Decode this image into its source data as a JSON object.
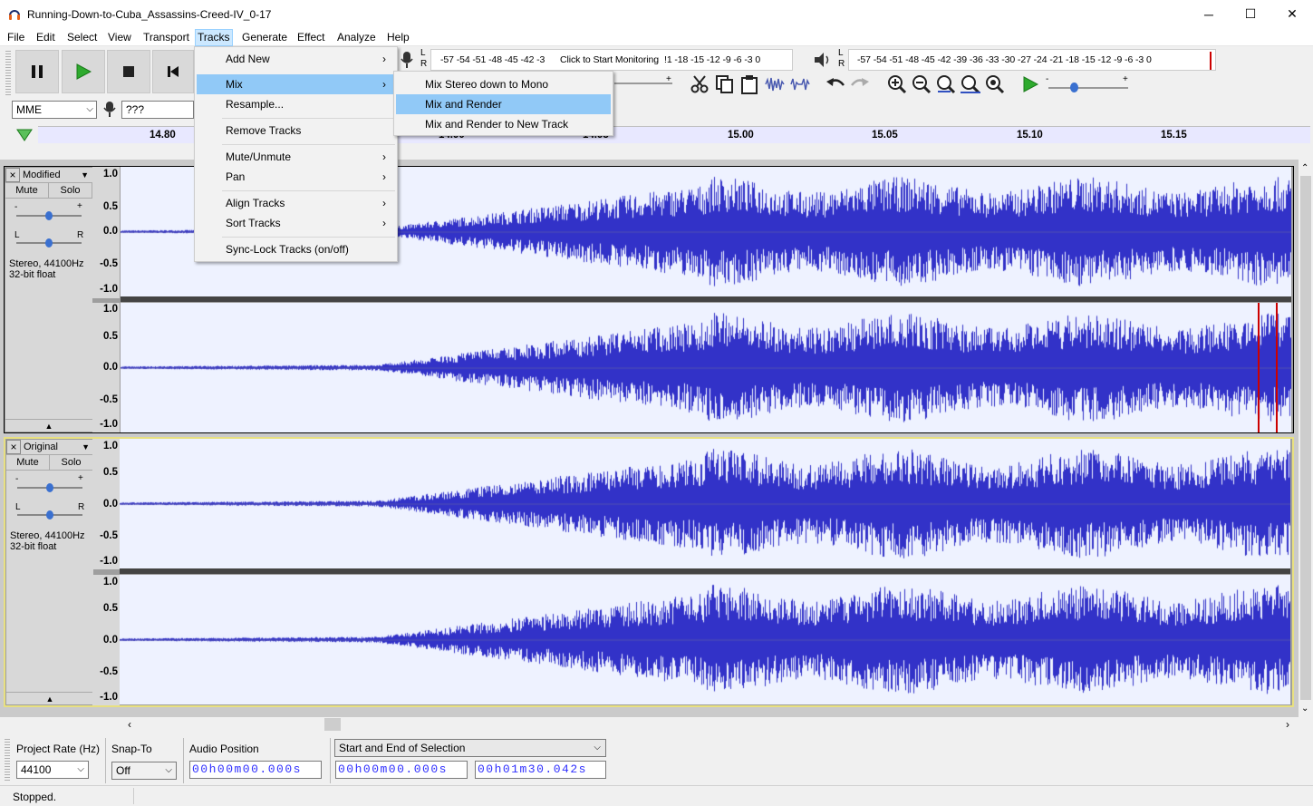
{
  "window": {
    "title": "Running-Down-to-Cuba_Assassins-Creed-IV_0-17",
    "minimize": "─",
    "maximize": "☐",
    "close": "✕"
  },
  "menubar": [
    "File",
    "Edit",
    "Select",
    "View",
    "Transport",
    "Tracks",
    "Generate",
    "Effect",
    "Analyze",
    "Help"
  ],
  "meters": {
    "rec_scale": "-57 -54 -51 -48 -45 -42 -3",
    "monitor_hint": "Click to Start Monitoring",
    "rec_scale_tail": "!1 -18 -15 -12  -9  -6  -3  0",
    "play_scale": "-57 -54 -51 -48 -45 -42 -39 -36 -33 -30 -27 -24 -21 -18 -15 -12  -9  -6  -3  0",
    "lr_l": "L",
    "lr_r": "R"
  },
  "device": {
    "host": "MME",
    "input": "??? (Realtek(R)"
  },
  "ruler": {
    "ticks": [
      "14.80",
      "14.90",
      "14.95",
      "15.00",
      "15.05",
      "15.10",
      "15.15"
    ]
  },
  "tracks": [
    {
      "name": "Modified",
      "mute": "Mute",
      "solo": "Solo",
      "gain_minus": "-",
      "gain_plus": "+",
      "pan_l": "L",
      "pan_r": "R",
      "rate": "Stereo, 44100Hz",
      "format": "32-bit float",
      "selected": false
    },
    {
      "name": "Original",
      "mute": "Mute",
      "solo": "Solo",
      "gain_minus": "-",
      "gain_plus": "+",
      "pan_l": "L",
      "pan_r": "R",
      "rate": "Stereo, 44100Hz",
      "format": "32-bit float",
      "selected": true
    }
  ],
  "amplitude_labels": [
    "1.0",
    "0.5",
    "0.0",
    "-0.5",
    "-1.0"
  ],
  "tracks_menu": {
    "items": [
      "Add New",
      "Mix",
      "Resample...",
      "Remove Tracks",
      "Mute/Unmute",
      "Pan",
      "Align Tracks",
      "Sort Tracks",
      "Sync-Lock Tracks (on/off)"
    ],
    "highlighted": "Mix"
  },
  "mix_submenu": {
    "items": [
      "Mix Stereo down to Mono",
      "Mix and Render",
      "Mix and Render to New Track"
    ],
    "highlighted": "Mix and Render"
  },
  "selection_toolbar": {
    "project_rate_label": "Project Rate (Hz)",
    "project_rate": "44100",
    "snap_label": "Snap-To",
    "snap_value": "Off",
    "audio_pos_label": "Audio Position",
    "audio_pos": "00h00m00.000s",
    "selection_mode": "Start and End of Selection",
    "sel_start": "00h00m00.000s",
    "sel_end": "00h01m30.042s"
  },
  "status": "Stopped.",
  "colors": {
    "waveform": "#3232c8",
    "wave_bg": "#eef2ff",
    "menu_highlight": "#91c9f7",
    "playhead": "#cc0000"
  }
}
